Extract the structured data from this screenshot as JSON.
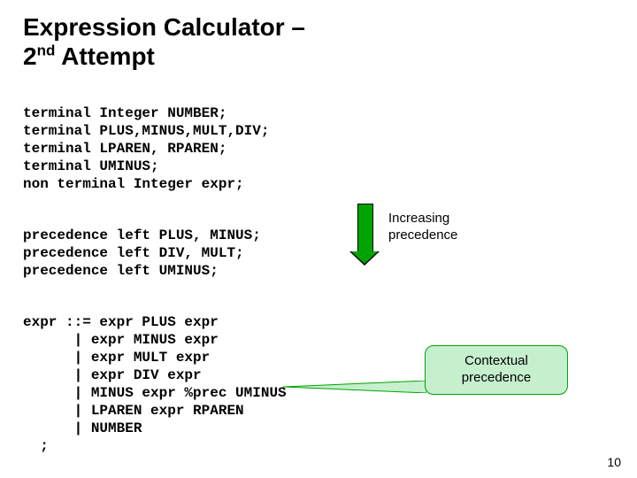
{
  "title": {
    "line1": "Expression Calculator –",
    "line2a": "2",
    "line2sup": "nd",
    "line2b": " Attempt"
  },
  "terminals": [
    "terminal Integer NUMBER;",
    "terminal PLUS,MINUS,MULT,DIV;",
    "terminal LPAREN, RPAREN;",
    "terminal UMINUS;",
    "non terminal Integer expr;"
  ],
  "precedence": [
    "precedence left PLUS, MINUS;",
    "precedence left DIV, MULT;",
    "precedence left UMINUS;"
  ],
  "grammar": [
    "expr ::= expr PLUS expr",
    "      | expr MINUS expr",
    "      | expr MULT expr",
    "      | expr DIV expr",
    "      | MINUS expr %prec UMINUS",
    "      | LPAREN expr RPAREN",
    "      | NUMBER",
    "  ;"
  ],
  "arrow_label": "Increasing\nprecedence",
  "callout": "Contextual\nprecedence",
  "page_number": "10"
}
